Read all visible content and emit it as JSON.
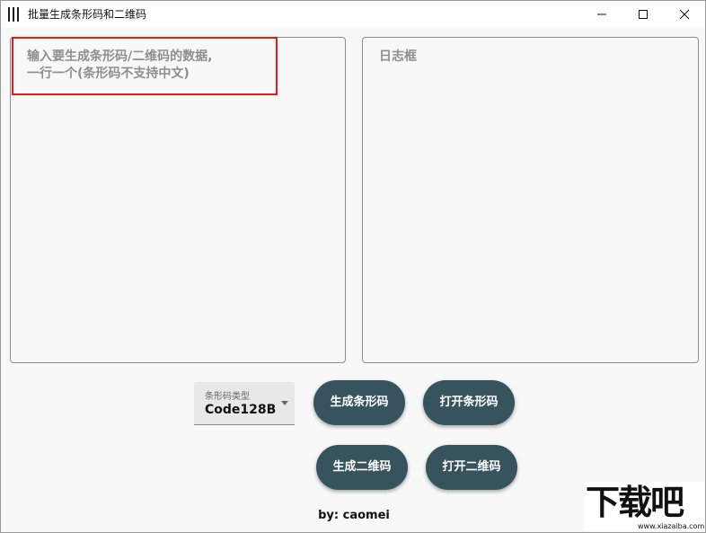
{
  "window": {
    "title": "批量生成条形码和二维码",
    "minimize_icon": "minimize-icon",
    "maximize_icon": "maximize-icon",
    "close_icon": "close-icon"
  },
  "input_panel": {
    "placeholder_line1": "输入要生成条形码/二维码的数据,",
    "placeholder_line2": "一行一个(条形码不支持中文)"
  },
  "log_panel": {
    "placeholder": "日志框"
  },
  "barcode_type": {
    "label": "条形码类型",
    "value": "Code128B"
  },
  "buttons": {
    "generate_barcode": "生成条形码",
    "open_barcode": "打开条形码",
    "generate_qrcode": "生成二维码",
    "open_qrcode": "打开二维码"
  },
  "footer": {
    "credit": "by: caomei"
  },
  "watermark": {
    "text": "下载吧",
    "url": "www.xiazaiba.com"
  },
  "colors": {
    "button_bg": "#37535e",
    "highlight_border": "#e11b1b"
  }
}
